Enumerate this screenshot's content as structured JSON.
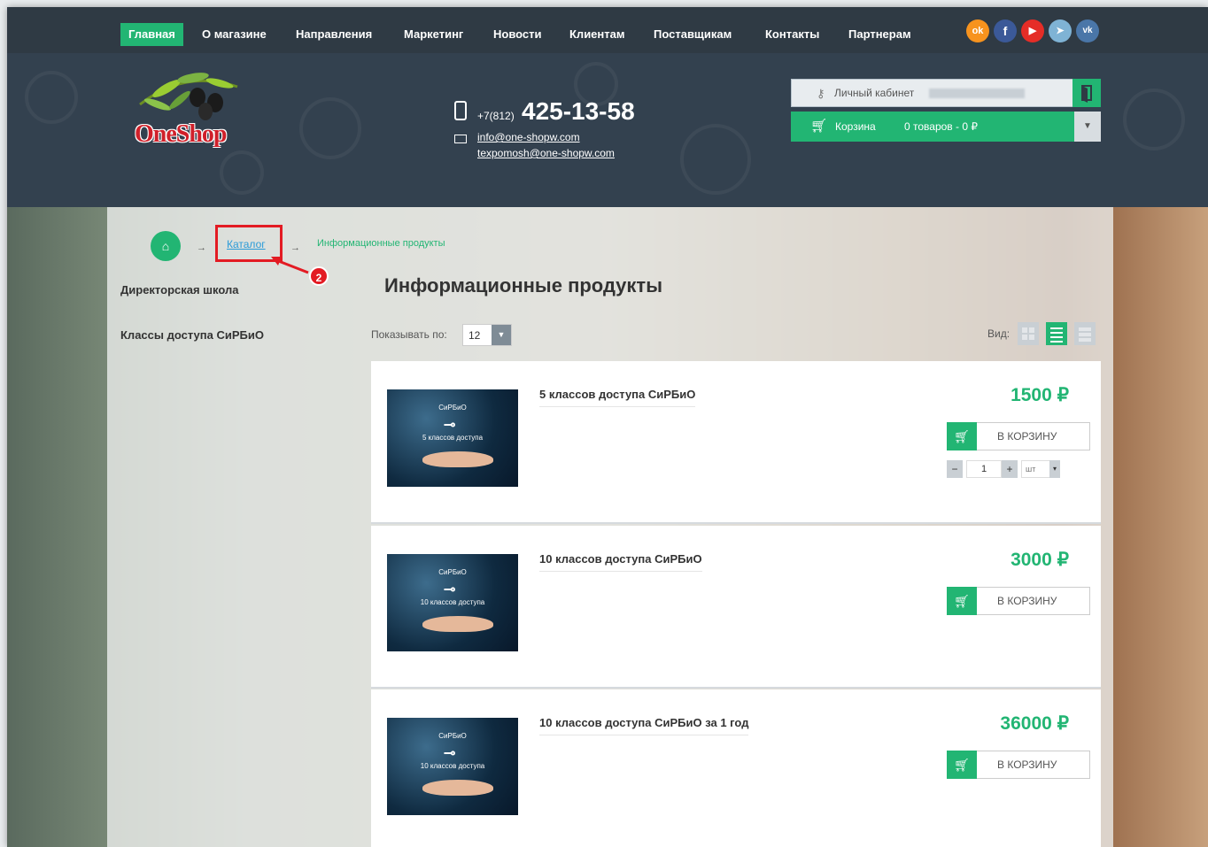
{
  "nav": {
    "items": [
      "Главная",
      "О магазине",
      "Направления",
      "Маркетинг",
      "Новости",
      "Клиентам",
      "Поставщикам",
      "Контакты",
      "Партнерам"
    ],
    "social": [
      {
        "icon": "odnoklassniki-icon",
        "glyph": "ok",
        "color": "#f7931e"
      },
      {
        "icon": "facebook-icon",
        "glyph": "f",
        "color": "#3b5998"
      },
      {
        "icon": "youtube-icon",
        "glyph": "▶",
        "color": "#e52d27"
      },
      {
        "icon": "telegram-icon",
        "glyph": "➤",
        "color": "#7fb3d5"
      },
      {
        "icon": "vk-icon",
        "glyph": "vk",
        "color": "#4a76a8"
      }
    ]
  },
  "header": {
    "logo_text_1": "One",
    "logo_text_2": "Shop",
    "phone_prefix": "+7(812)",
    "phone": "425-13-58",
    "email": "info@one-shopw.com",
    "support_email": "texpomosh@one-shopw.com",
    "account_label": "Личный кабинет",
    "cart_label": "Корзина",
    "cart_info": "0 товаров - 0 ₽"
  },
  "breadcrumb": {
    "catalog": "Каталог",
    "current": "Информационные продукты",
    "separator": "→",
    "marker": "2"
  },
  "sidebar": {
    "items": [
      "Директорская школа",
      "Классы доступа СиРБиО"
    ]
  },
  "content": {
    "title": "Информационные продукты",
    "perpage_label": "Показывать по:",
    "perpage_value": "12",
    "view_label": "Вид:"
  },
  "products": [
    {
      "name": "5 классов доступа СиРБиО",
      "price": "1500 ₽",
      "cart_label": "В КОРЗИНУ",
      "qty": "1",
      "unit": "шт",
      "thumb_brand": "СиРБиО",
      "thumb_caption": "5 классов доступа"
    },
    {
      "name": "10 классов доступа СиРБиО",
      "price": "3000 ₽",
      "cart_label": "В КОРЗИНУ",
      "thumb_brand": "СиРБиО",
      "thumb_caption": "10 классов доступа"
    },
    {
      "name": "10 классов доступа СиРБиО за 1 год",
      "price": "36000 ₽",
      "cart_label": "В КОРЗИНУ",
      "thumb_brand": "СиРБиО",
      "thumb_caption": "10 классов доступа"
    }
  ],
  "colors": {
    "accent": "#22b573",
    "nav_bg": "#2f3a44",
    "header_bg": "#33414f",
    "highlight": "#e31b23",
    "link": "#2a9bd8"
  }
}
